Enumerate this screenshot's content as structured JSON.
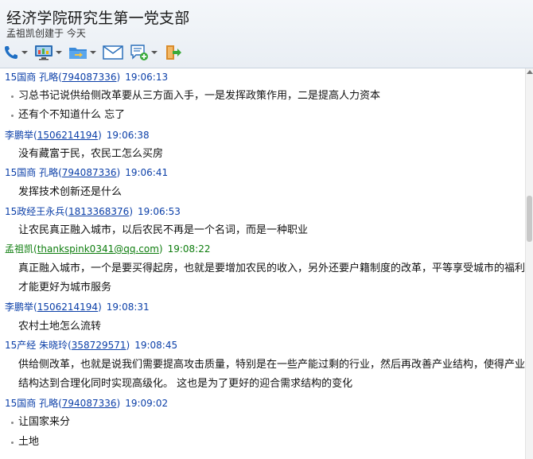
{
  "window": {
    "title": "经济学院研究生第一党支部",
    "subtitle": "孟祖凯创建于 今天"
  },
  "toolbar": [
    {
      "icon": "phone-icon",
      "has_dropdown": true
    },
    {
      "icon": "screen-share-icon",
      "has_dropdown": true
    },
    {
      "icon": "folder-transfer-icon",
      "has_dropdown": true
    },
    {
      "icon": "mail-icon",
      "has_dropdown": false
    },
    {
      "icon": "add-note-icon",
      "has_dropdown": true
    },
    {
      "icon": "exit-group-icon",
      "has_dropdown": false
    }
  ],
  "colors": {
    "sender_blue": "#0b3fa8",
    "sender_green": "#0e7d0e"
  },
  "messages": [
    {
      "sender": "15国商 孔略",
      "id": "794087336",
      "time": "19:06:13",
      "color": "blue",
      "lines": [
        "习总书记说供给侧改革要从三方面入手，一是发挥政策作用，二是提高人力资本",
        "还有个不知道什么 忘了"
      ],
      "bulleted": true
    },
    {
      "sender": "李鹏举",
      "id": "1506214194",
      "time": "19:06:38",
      "color": "blue",
      "lines": [
        "没有藏富于民，农民工怎么买房"
      ],
      "bulleted": false
    },
    {
      "sender": "15国商 孔略",
      "id": "794087336",
      "time": "19:06:41",
      "color": "blue",
      "lines": [
        "发挥技术创新还是什么"
      ],
      "bulleted": false
    },
    {
      "sender": "15政经王永兵",
      "id": "1813368376",
      "time": "19:06:53",
      "color": "blue",
      "lines": [
        "让农民真正融入城市，以后农民不再是一个名词，而是一种职业"
      ],
      "bulleted": false
    },
    {
      "sender": "孟祖凯",
      "id": "thankspink0341@qq.com",
      "time": "19:08:22",
      "color": "green",
      "lines": [
        "真正融入城市，一个是要买得起房，也就是要增加农民的收入，另外还要户籍制度的改革，平等享受城市的福利",
        "才能更好为城市服务"
      ],
      "bulleted": false
    },
    {
      "sender": "李鹏举",
      "id": "1506214194",
      "time": "19:08:31",
      "color": "blue",
      "lines": [
        "农村土地怎么流转"
      ],
      "bulleted": false
    },
    {
      "sender": "15产经 朱晓玲",
      "id": "358729571",
      "time": "19:08:45",
      "color": "blue",
      "lines": [
        "供给侧改革，也就是说我们需要提高攻击质量，特别是在一些产能过剩的行业，然后再改善产业结构，使得产业",
        "结构达到合理化同时实现高级化。 这也是为了更好的迎合需求结构的变化"
      ],
      "bulleted": false
    },
    {
      "sender": "15国商 孔略",
      "id": "794087336",
      "time": "19:09:02",
      "color": "blue",
      "lines": [
        "让国家来分",
        "土地"
      ],
      "bulleted": true
    }
  ]
}
